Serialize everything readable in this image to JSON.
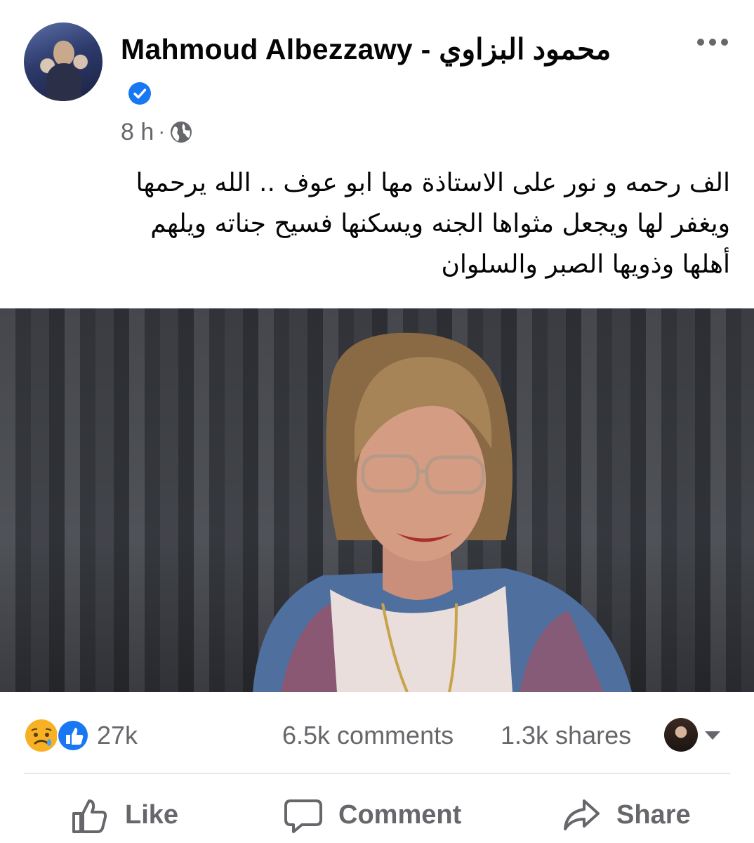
{
  "post": {
    "author": "Mahmoud Albezzawy - محمود  البزاوي",
    "time": "8 h",
    "meta_separator": "·",
    "text_lines": [
      "الف رحمه و نور على الاستاذة مها ابو عوف .. الله يرحمها",
      "ويغفر لها ويجعل مثواها الجنه ويسكنها فسيح جناته ويلهم",
      "أهلها وذويها الصبر والسلوان"
    ]
  },
  "engagement": {
    "reactions_count": "27k",
    "comments": "6.5k comments",
    "shares": "1.3k shares"
  },
  "actions": {
    "like": "Like",
    "comment": "Comment",
    "share": "Share"
  },
  "colors": {
    "verified_blue": "#1877f2",
    "secondary_text": "#65676b",
    "sad_yellow": "#f7b125",
    "like_blue": "#1877f2"
  },
  "icons": {
    "verified": "verified-badge-icon",
    "more": "more-options-icon",
    "privacy": "globe-icon",
    "like": "thumbs-up-icon",
    "comment": "speech-bubble-icon",
    "share": "share-arrow-icon"
  }
}
